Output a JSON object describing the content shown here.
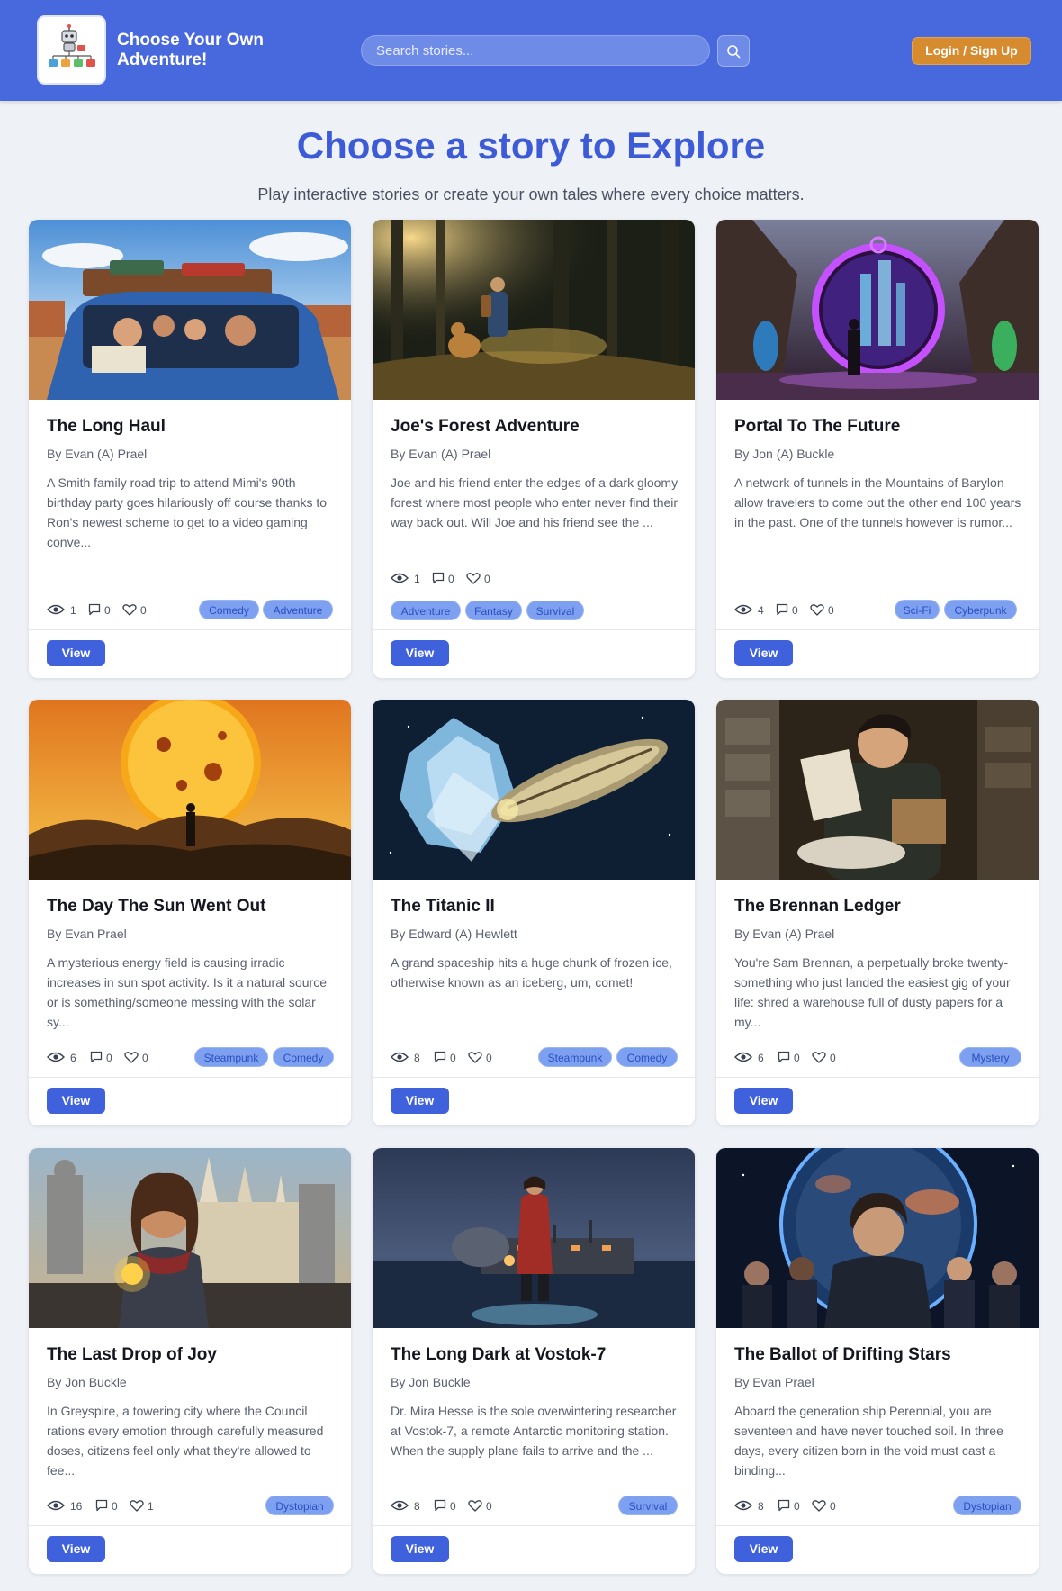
{
  "header": {
    "brand": "Choose Your Own Adventure!",
    "search_placeholder": "Search stories...",
    "login_label": "Login / Sign Up"
  },
  "hero": {
    "title": "Choose a story to Explore",
    "subtitle": "Play interactive stories or create your own tales where every choice matters."
  },
  "stories": [
    {
      "title": "The Long Haul",
      "author": "By Evan (A) Prael",
      "description": "A Smith family road trip to attend Mimi's 90th birthday party goes hilariously off course thanks to Ron's newest scheme to get to a video gaming conve...",
      "views": "1",
      "comments": "0",
      "likes": "0",
      "tags": [
        "Comedy",
        "Adventure"
      ],
      "view_label": "View"
    },
    {
      "title": "Joe's Forest Adventure",
      "author": "By Evan (A) Prael",
      "description": "Joe and his friend enter the edges of a dark gloomy forest where most people who enter never find their way back out. Will Joe and his friend see the ...",
      "views": "1",
      "comments": "0",
      "likes": "0",
      "tags": [
        "Adventure",
        "Fantasy",
        "Survival"
      ],
      "view_label": "View"
    },
    {
      "title": "Portal To The Future",
      "author": "By Jon (A) Buckle",
      "description": "A network of tunnels in the Mountains of Barylon allow travelers to come out the other end 100 years in the past. One of the tunnels however is rumor...",
      "views": "4",
      "comments": "0",
      "likes": "0",
      "tags": [
        "Sci-Fi",
        "Cyberpunk"
      ],
      "view_label": "View"
    },
    {
      "title": "The Day The Sun Went Out",
      "author": "By Evan Prael",
      "description": "A mysterious energy field is causing irradic increases in sun spot activity. Is it a natural source or is something/someone messing with the solar sy...",
      "views": "6",
      "comments": "0",
      "likes": "0",
      "tags": [
        "Steampunk",
        "Comedy"
      ],
      "view_label": "View"
    },
    {
      "title": "The Titanic II",
      "author": "By Edward (A) Hewlett",
      "description": "A grand spaceship hits a huge chunk of frozen ice, otherwise known as an iceberg, um, comet!",
      "views": "8",
      "comments": "0",
      "likes": "0",
      "tags": [
        "Steampunk",
        "Comedy"
      ],
      "view_label": "View"
    },
    {
      "title": "The Brennan Ledger",
      "author": "By Evan (A) Prael",
      "description": "You're Sam Brennan, a perpetually broke twenty-something who just landed the easiest gig of your life: shred a warehouse full of dusty papers for a my...",
      "views": "6",
      "comments": "0",
      "likes": "0",
      "tags": [
        "Mystery"
      ],
      "view_label": "View"
    },
    {
      "title": "The Last Drop of Joy",
      "author": "By Jon Buckle",
      "description": "In Greyspire, a towering city where the Council rations every emotion through carefully measured doses, citizens feel only what they're allowed to fee...",
      "views": "16",
      "comments": "0",
      "likes": "1",
      "tags": [
        "Dystopian"
      ],
      "view_label": "View"
    },
    {
      "title": "The Long Dark at Vostok-7",
      "author": "By Jon Buckle",
      "description": "Dr. Mira Hesse is the sole overwintering researcher at Vostok-7, a remote Antarctic monitoring station. When the supply plane fails to arrive and the ...",
      "views": "8",
      "comments": "0",
      "likes": "0",
      "tags": [
        "Survival"
      ],
      "view_label": "View"
    },
    {
      "title": "The Ballot of Drifting Stars",
      "author": "By Evan Prael",
      "description": "Aboard the generation ship Perennial, you are seventeen and have never touched soil. In three days, every citizen born in the void must cast a binding...",
      "views": "8",
      "comments": "0",
      "likes": "0",
      "tags": [
        "Dystopian"
      ],
      "view_label": "View"
    }
  ]
}
